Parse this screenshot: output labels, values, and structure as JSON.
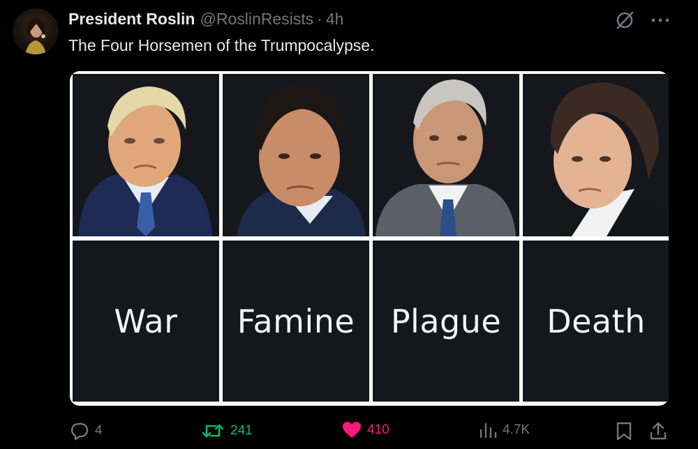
{
  "author": {
    "display_name": "President Roslin",
    "handle": "@RoslinResists",
    "separator": "·",
    "time": "4h"
  },
  "tweet": {
    "text": "The Four Horsemen of the Trumpocalypse."
  },
  "media": {
    "labels": [
      "War",
      "Famine",
      "Plague",
      "Death"
    ]
  },
  "engagement": {
    "replies": "4",
    "retweets": "241",
    "likes": "410",
    "views": "4.7K"
  },
  "colors": {
    "background": "#000000",
    "retweet": "#00ba7c",
    "like": "#f91880",
    "muted": "#71767b",
    "text": "#e7e9ea"
  },
  "icons": {
    "reply": "reply-icon",
    "retweet": "retweet-icon",
    "like": "heart-icon",
    "views": "views-icon",
    "bookmark": "bookmark-icon",
    "share": "share-icon",
    "grok": "grok-icon",
    "more": "more-icon"
  }
}
